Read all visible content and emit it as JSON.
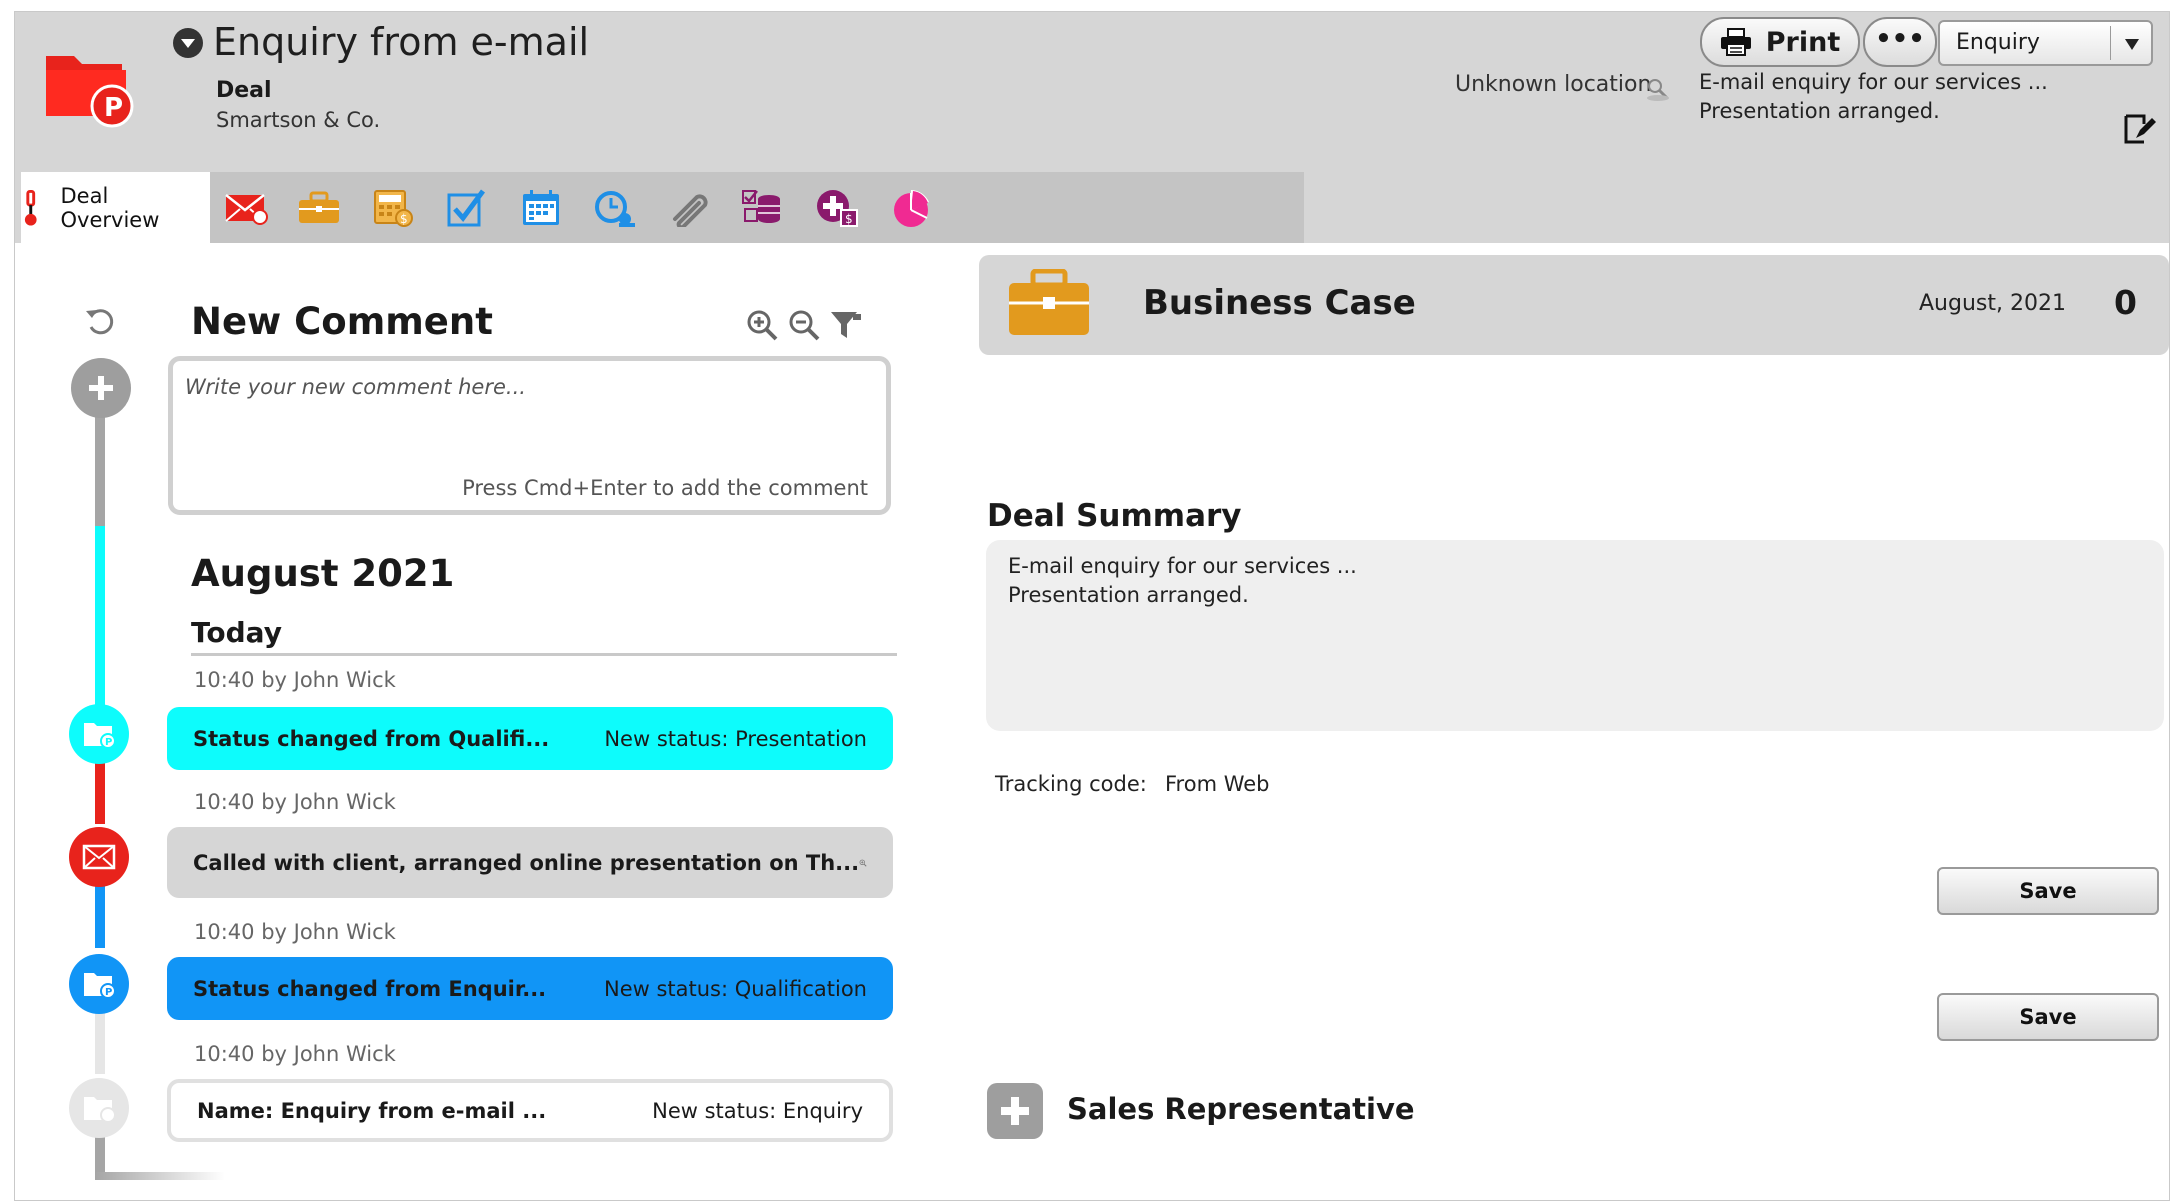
{
  "header": {
    "title": "Enquiry from e-mail",
    "kind": "Deal",
    "company": "Smartson & Co.",
    "location": "Unknown location",
    "print_label": "Print",
    "more_label": "•••",
    "status_value": "Enquiry",
    "summary_line1": "E-mail enquiry for our services ...",
    "summary_line2": "Presentation arranged."
  },
  "tabs": {
    "active_label": "Deal Overview",
    "items": [
      "mail-icon",
      "briefcase-icon",
      "calculator-icon",
      "checklist-icon",
      "calendar-icon",
      "clock-icon",
      "paperclip-icon",
      "coins-icon",
      "add-money-icon",
      "pie-chart-icon"
    ]
  },
  "comments": {
    "title": "New Comment",
    "placeholder": "Write your new comment here...",
    "hint": "Press Cmd+Enter to add the comment",
    "month": "August 2021",
    "day": "Today",
    "entries": [
      {
        "meta": "10:40 by John Wick",
        "left": "Status changed from Qualifi...",
        "right": "New status: Presentation",
        "color": "#0dfcfc"
      },
      {
        "meta": "10:40 by John Wick",
        "left": "Called with client, arranged online presentation on Th...",
        "right": "",
        "color": "#d6d6d6"
      },
      {
        "meta": "10:40 by John Wick",
        "left": "Status changed from Enquir...",
        "right": "New status: Qualification",
        "color": "#1195f6"
      },
      {
        "meta": "10:40 by John Wick",
        "left": "Name: Enquiry from e-mail  ...",
        "right": "New status: Enquiry",
        "color": "#ffffff"
      }
    ]
  },
  "business_case": {
    "title": "Business Case",
    "date": "August, 2021",
    "count": "0"
  },
  "deal_summary": {
    "title": "Deal Summary",
    "line1": "E-mail enquiry for our services ...",
    "line2": "Presentation arranged."
  },
  "tracking": {
    "label": "Tracking code:",
    "value": "From Web"
  },
  "buttons": {
    "save1": "Save",
    "save2": "Save"
  },
  "sales_rep": {
    "title": "Sales Representative"
  },
  "colors": {
    "header_bg": "#d6d6d6",
    "cyan": "#0dfcfc",
    "blue": "#1195f6",
    "red": "#e8231c",
    "orange": "#e29a1e"
  }
}
